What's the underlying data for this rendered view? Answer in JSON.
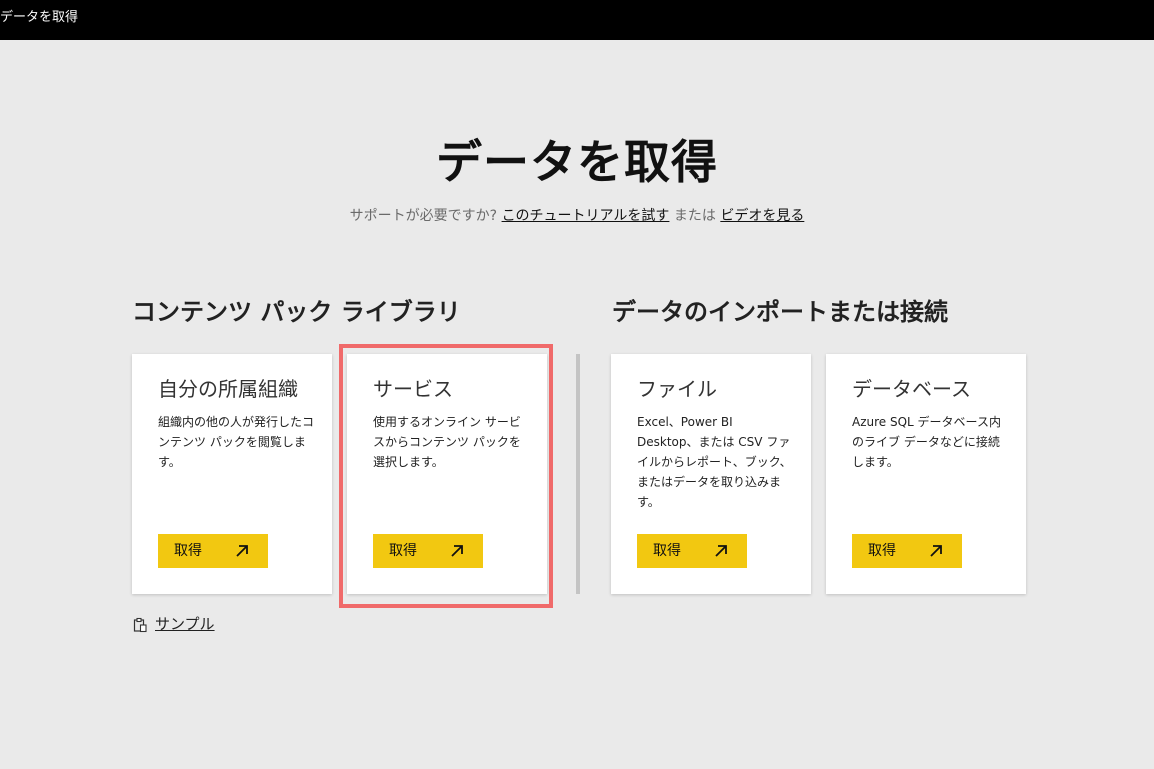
{
  "window": {
    "title": "データを取得"
  },
  "header": {
    "title": "データを取得",
    "help_prefix": "サポートが必要ですか?",
    "tutorial_link": "このチュートリアルを試す",
    "or_text": "または",
    "video_link": "ビデオを見る"
  },
  "sections": {
    "content_pack_library": "コンテンツ パック ライブラリ",
    "import_or_connect": "データのインポートまたは接続"
  },
  "cards": [
    {
      "title": "自分の所属組織",
      "description": "組織内の他の人が発行したコンテンツ パックを閲覧します。",
      "button": "取得"
    },
    {
      "title": "サービス",
      "description": "使用するオンライン サービスからコンテンツ パックを選択します。",
      "button": "取得"
    },
    {
      "title": "ファイル",
      "description": "Excel、Power BI Desktop、または CSV ファイルからレポート、ブック、またはデータを取り込みます。",
      "button": "取得"
    },
    {
      "title": "データベース",
      "description": "Azure SQL データベース内のライブ データなどに接続します。",
      "button": "取得"
    }
  ],
  "sample": {
    "label": "サンプル",
    "icon": "clipboard-icon"
  },
  "colors": {
    "accent_button": "#f2c811",
    "highlight_border": "#f06a6a",
    "background": "#eaeaea",
    "titlebar": "#000000"
  }
}
